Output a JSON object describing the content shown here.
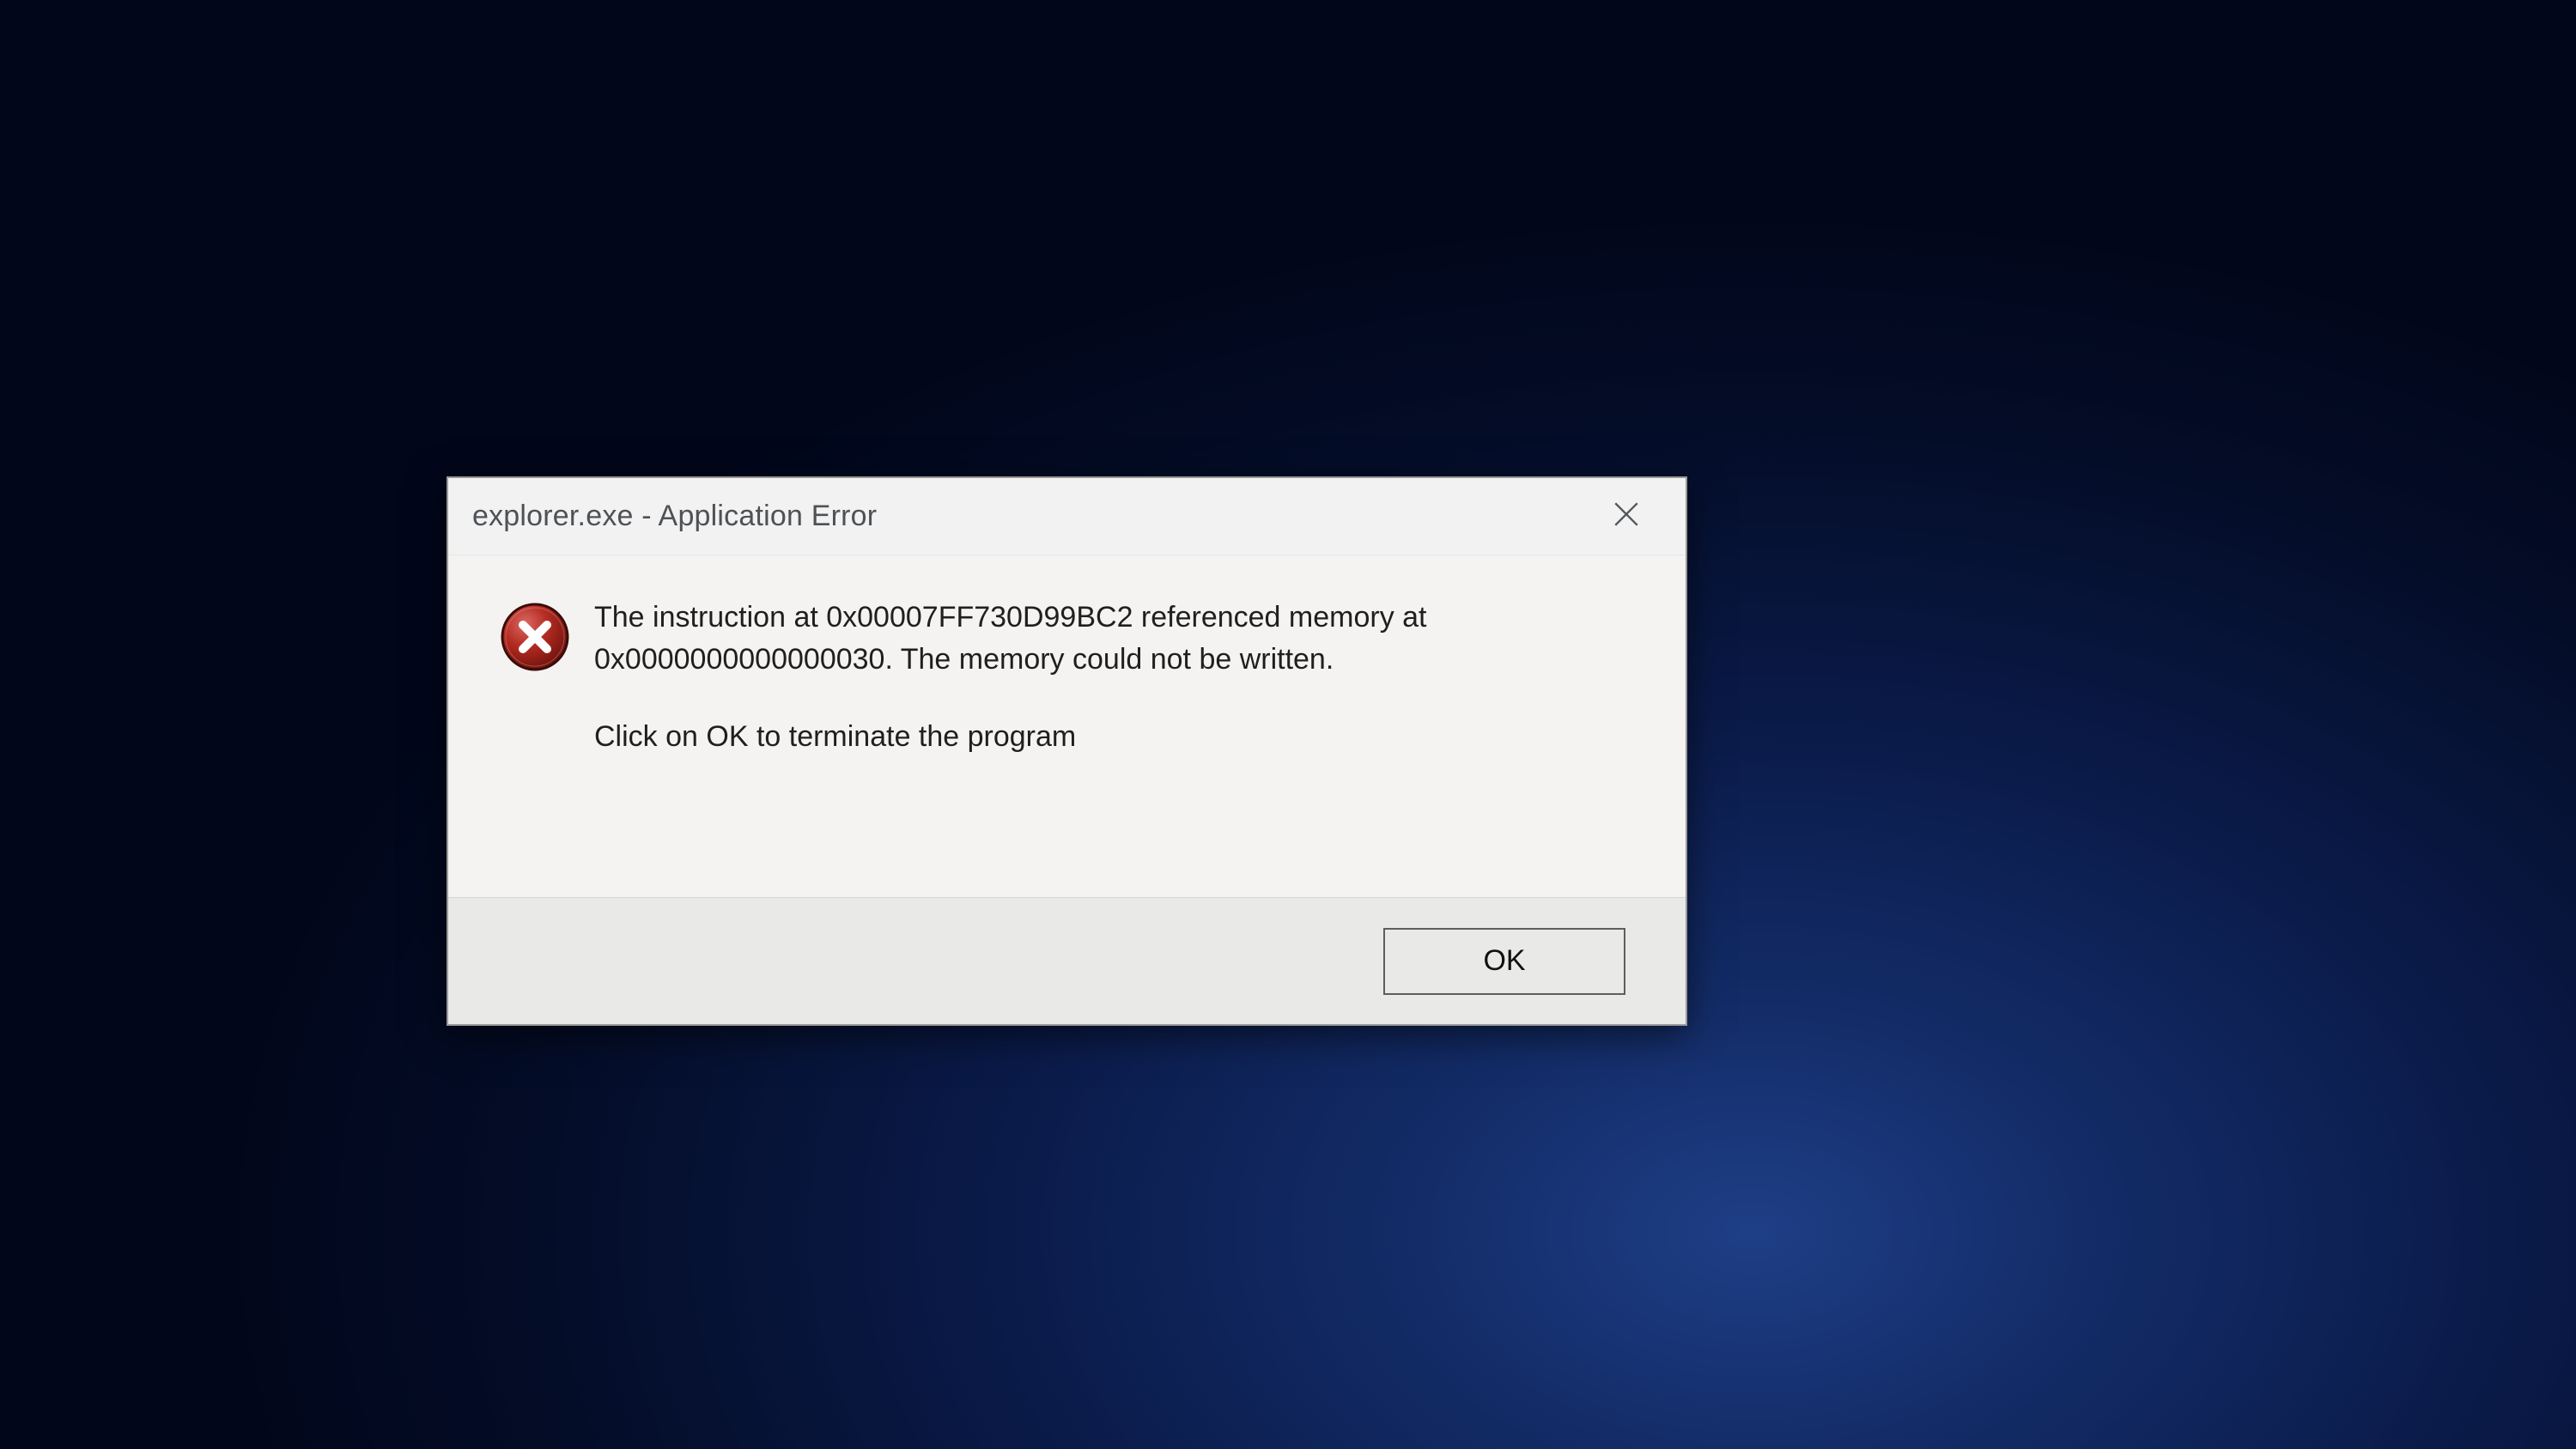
{
  "dialog": {
    "title": "explorer.exe - Application Error",
    "message_line1": "The instruction at 0x00007FF730D99BC2 referenced memory at 0x0000000000000030. The memory could not be written.",
    "message_line2": "Click on OK to terminate the program",
    "ok_label": "OK"
  }
}
